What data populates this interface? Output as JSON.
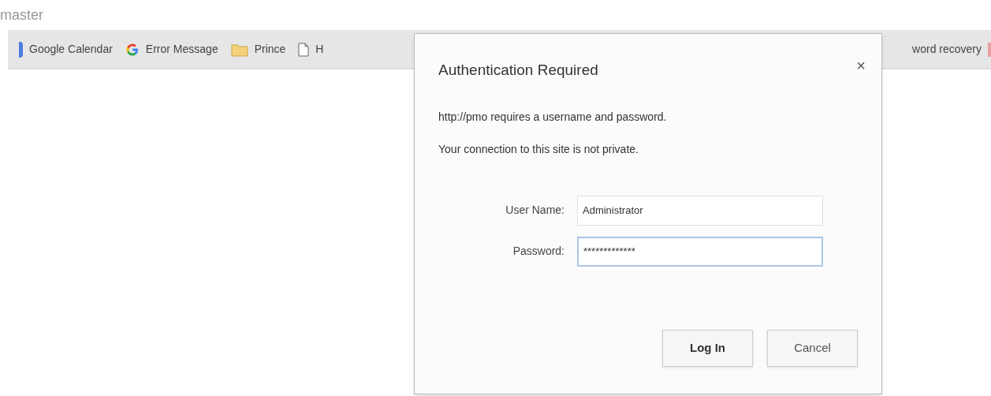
{
  "page_title": "master",
  "bookmarks": [
    {
      "kind": "calendar",
      "label": "Google Calendar"
    },
    {
      "kind": "google",
      "label": "Error Message"
    },
    {
      "kind": "folder",
      "label": "Prince"
    },
    {
      "kind": "page",
      "label": "H"
    }
  ],
  "bookmarks_right": [
    {
      "label": "word recovery"
    }
  ],
  "dialog": {
    "title": "Authentication Required",
    "close": "×",
    "messages": [
      "http://pmo requires a username and password.",
      "Your connection to this site is not private."
    ],
    "fields": [
      {
        "label": "User Name:",
        "value": "Administrator",
        "focused": false
      },
      {
        "label": "Password:",
        "value": "*************",
        "focused": true
      }
    ],
    "buttons": [
      {
        "label": "Log In",
        "primary": true
      },
      {
        "label": "Cancel",
        "primary": false
      }
    ]
  }
}
